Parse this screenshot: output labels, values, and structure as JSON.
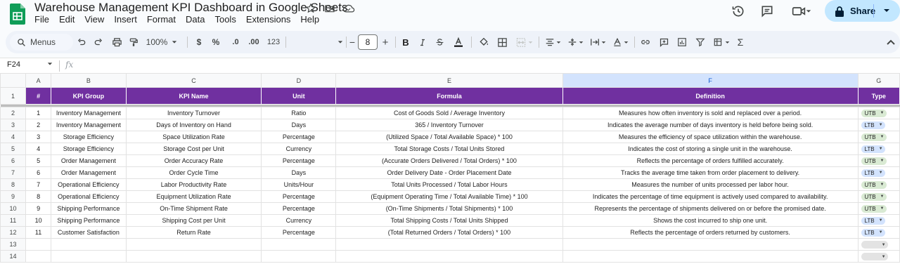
{
  "app": {
    "title": "Warehouse Management KPI Dashboard in Google Sheets",
    "menu": [
      "File",
      "Edit",
      "View",
      "Insert",
      "Format",
      "Data",
      "Tools",
      "Extensions",
      "Help"
    ],
    "share_label": "Share",
    "brand_color": "#0f9d58",
    "share_bg": "#c2e7ff"
  },
  "toolbar": {
    "search_label": "Menus",
    "zoom": "100%",
    "currency": "$",
    "percent": "%",
    "decrease_decimal": ".0",
    "increase_decimal": ".00",
    "number_format": "123",
    "font_size": "8",
    "minus": "−",
    "plus": "+",
    "bold": "B",
    "sum": "Σ"
  },
  "formula_bar": {
    "cell_ref": "F24",
    "fx": "fx"
  },
  "sheet": {
    "columns": [
      "A",
      "B",
      "C",
      "D",
      "E",
      "F",
      "G"
    ],
    "selected_column": "F",
    "header_color": "#7030a0",
    "headers": [
      "#",
      "KPI Group",
      "KPI Name",
      "Unit",
      "Formula",
      "Definition",
      "Type"
    ],
    "rows": [
      {
        "num": "1",
        "group": "Inventory Management",
        "name": "Inventory Turnover",
        "unit": "Ratio",
        "formula": "Cost of Goods Sold / Average Inventory",
        "definition": "Measures how often inventory is sold and replaced over a period.",
        "type": "UTB"
      },
      {
        "num": "2",
        "group": "Inventory Management",
        "name": "Days of Inventory on Hand",
        "unit": "Days",
        "formula": "365 / Inventory Turnover",
        "definition": "Indicates the average number of days inventory is held before being sold.",
        "type": "LTB"
      },
      {
        "num": "3",
        "group": "Storage Efficiency",
        "name": "Space Utilization Rate",
        "unit": "Percentage",
        "formula": "(Utilized Space / Total Available Space) * 100",
        "definition": "Measures the efficiency of space utilization within the warehouse.",
        "type": "UTB"
      },
      {
        "num": "4",
        "group": "Storage Efficiency",
        "name": "Storage Cost per Unit",
        "unit": "Currency",
        "formula": "Total Storage Costs / Total Units Stored",
        "definition": "Indicates the cost of storing a single unit in the warehouse.",
        "type": "LTB"
      },
      {
        "num": "5",
        "group": "Order Management",
        "name": "Order Accuracy Rate",
        "unit": "Percentage",
        "formula": "(Accurate Orders Delivered / Total Orders) * 100",
        "definition": "Reflects the percentage of orders fulfilled accurately.",
        "type": "UTB"
      },
      {
        "num": "6",
        "group": "Order Management",
        "name": "Order Cycle Time",
        "unit": "Days",
        "formula": "Order Delivery Date - Order Placement Date",
        "definition": "Tracks the average time taken from order placement to delivery.",
        "type": "LTB"
      },
      {
        "num": "7",
        "group": "Operational Efficiency",
        "name": "Labor Productivity Rate",
        "unit": "Units/Hour",
        "formula": "Total Units Processed / Total Labor Hours",
        "definition": "Measures the number of units processed per labor hour.",
        "type": "UTB"
      },
      {
        "num": "8",
        "group": "Operational Efficiency",
        "name": "Equipment Utilization Rate",
        "unit": "Percentage",
        "formula": "(Equipment Operating Time / Total Available Time) * 100",
        "definition": "Indicates the percentage of time equipment is actively used compared to availability.",
        "type": "UTB"
      },
      {
        "num": "9",
        "group": "Shipping Performance",
        "name": "On-Time Shipment Rate",
        "unit": "Percentage",
        "formula": "(On-Time Shipments / Total Shipments) * 100",
        "definition": "Represents the percentage of shipments delivered on or before the promised date.",
        "type": "UTB"
      },
      {
        "num": "10",
        "group": "Shipping Performance",
        "name": "Shipping Cost per Unit",
        "unit": "Currency",
        "formula": "Total Shipping Costs / Total Units Shipped",
        "definition": "Shows the cost incurred to ship one unit.",
        "type": "LTB"
      },
      {
        "num": "11",
        "group": "Customer Satisfaction",
        "name": "Return Rate",
        "unit": "Percentage",
        "formula": "(Total Returned Orders / Total Orders) * 100",
        "definition": "Reflects the percentage of orders returned by customers.",
        "type": "LTB"
      }
    ],
    "row_numbers": [
      "1",
      "2",
      "3",
      "4",
      "5",
      "6",
      "7",
      "8",
      "9",
      "10",
      "11",
      "12",
      "13",
      "14"
    ]
  }
}
